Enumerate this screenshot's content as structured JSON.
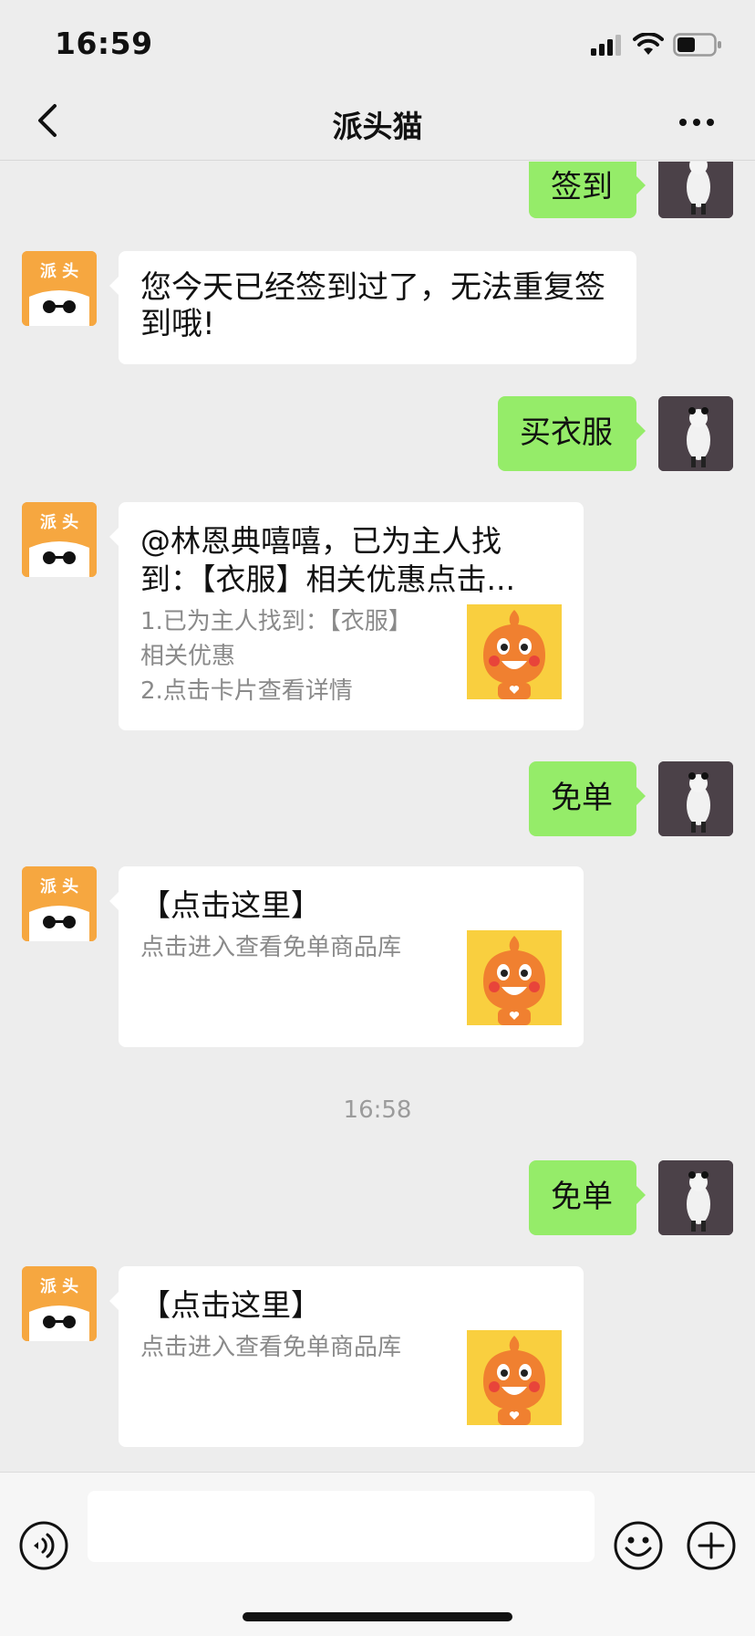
{
  "status_bar": {
    "time": "16:59"
  },
  "nav": {
    "title": "派头猫"
  },
  "bot": {
    "avatar_text": "派 头"
  },
  "messages": {
    "m1_user": "签到",
    "m2_bot": "您今天已经签到过了，无法重复签到哦!",
    "m3_user": "买衣服",
    "m4_card": {
      "title": "@林恩典嘻嘻，已为主人找到：【衣服】相关优惠点击...",
      "desc": "1.已为主人找到：【衣服】相关优惠\n2.点击卡片查看详情"
    },
    "m5_user": "免单",
    "m6_card": {
      "title": "【点击这里】",
      "desc": "点击进入查看免单商品库"
    },
    "timestamp": "16:58",
    "m7_user": "免单",
    "m8_card": {
      "title": "【点击这里】",
      "desc": "点击进入查看免单商品库"
    }
  },
  "colors": {
    "background": "#ededed",
    "user_bubble": "#95ec69",
    "bot_bubble": "#ffffff",
    "bot_avatar": "#f6a740",
    "card_thumb": "#f9cf3f"
  }
}
